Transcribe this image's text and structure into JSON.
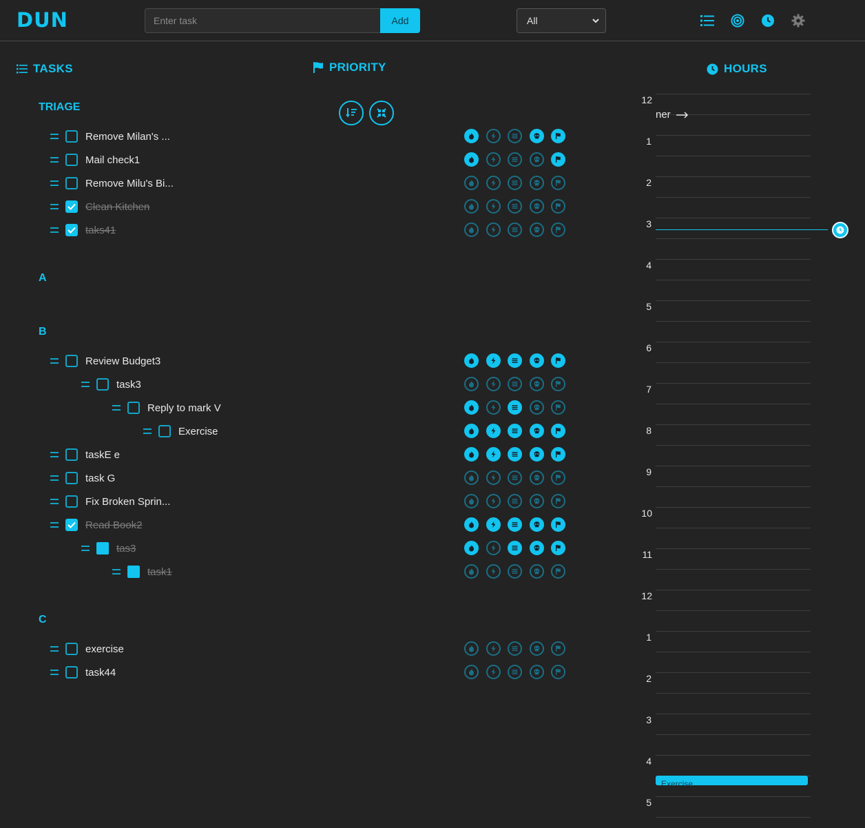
{
  "app": {
    "logo": "DUN"
  },
  "header": {
    "input_placeholder": "Enter task",
    "add_label": "Add",
    "filter_value": "All",
    "nav_icons": [
      "list-icon",
      "target-icon",
      "clock-icon",
      "gear-icon"
    ],
    "accent": "#12c4ef"
  },
  "columns": {
    "tasks": "TASKS",
    "priority": "PRIORITY",
    "hours": "HOURS"
  },
  "groups": {
    "triage": {
      "title": "TRIAGE",
      "tasks": [
        {
          "name": "Remove Milan's ...",
          "done": false,
          "prio": [
            1,
            0,
            0,
            1,
            1
          ]
        },
        {
          "name": "Mail check1",
          "done": false,
          "prio": [
            1,
            0,
            0,
            0,
            1
          ]
        },
        {
          "name": "Remove Milu's Bi...",
          "done": false,
          "prio": [
            0,
            0,
            0,
            0,
            0
          ]
        },
        {
          "name": "Clean Kitchen",
          "done": true,
          "prio": [
            0,
            0,
            0,
            0,
            0
          ]
        },
        {
          "name": "taks41",
          "done": true,
          "prio": [
            0,
            0,
            0,
            0,
            0
          ]
        }
      ]
    },
    "a": {
      "title": "A",
      "tasks": []
    },
    "b": {
      "title": "B",
      "tasks": [
        {
          "name": "Review Budget3",
          "done": false,
          "prio": [
            1,
            1,
            1,
            1,
            1
          ]
        },
        {
          "name": "task3",
          "done": false,
          "prio": [
            0,
            0,
            0,
            0,
            0
          ]
        },
        {
          "name": "Reply to mark V",
          "done": false,
          "prio": [
            1,
            0,
            1,
            0,
            0
          ]
        },
        {
          "name": "Exercise",
          "done": false,
          "prio": [
            1,
            1,
            1,
            1,
            1
          ]
        },
        {
          "name": "taskE e",
          "done": false,
          "prio": [
            1,
            1,
            1,
            1,
            1
          ]
        },
        {
          "name": "task G",
          "done": false,
          "prio": [
            0,
            0,
            0,
            0,
            0
          ]
        },
        {
          "name": "Fix Broken Sprin...",
          "done": false,
          "prio": [
            0,
            0,
            0,
            0,
            0
          ]
        },
        {
          "name": "Read Book2",
          "done": true,
          "prio": [
            1,
            1,
            1,
            1,
            1
          ]
        },
        {
          "name": "tas3",
          "done": true,
          "prio": [
            1,
            0,
            1,
            1,
            1
          ]
        },
        {
          "name": "task1",
          "done": true,
          "prio": [
            0,
            0,
            0,
            0,
            0
          ]
        }
      ]
    },
    "c": {
      "title": "C",
      "tasks": [
        {
          "name": "exercise",
          "done": false,
          "prio": [
            0,
            0,
            0,
            0,
            0
          ]
        },
        {
          "name": "task44",
          "done": false,
          "prio": [
            0,
            0,
            0,
            0,
            0
          ]
        }
      ]
    }
  },
  "priority_icons": [
    "fire-icon",
    "bolt-icon",
    "lines-icon",
    "skull-icon",
    "flag-icon"
  ],
  "hours": {
    "labels": [
      "12",
      "1",
      "2",
      "3",
      "4",
      "5",
      "6",
      "7",
      "8",
      "9",
      "10",
      "11",
      "12",
      "1",
      "2",
      "3",
      "4",
      "5"
    ],
    "peek_text": "ner",
    "event_label": "Exercise"
  }
}
